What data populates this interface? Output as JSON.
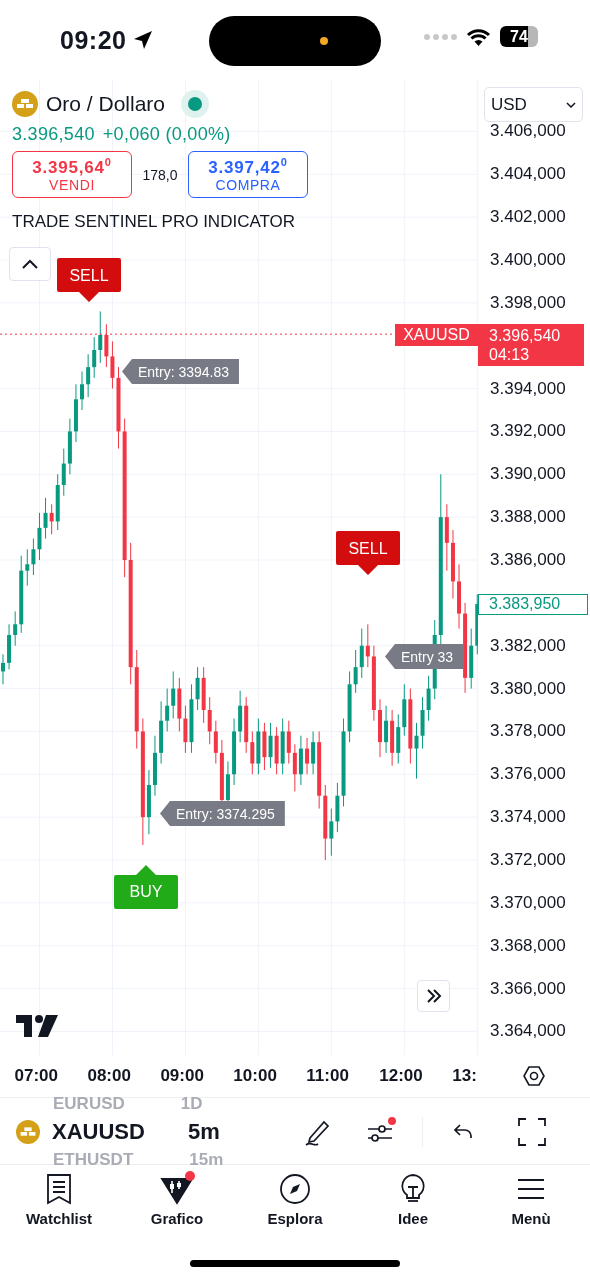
{
  "status_bar": {
    "time": "09:20",
    "battery": "74"
  },
  "symbol": {
    "name": "Oro / Dollaro",
    "market_open": true,
    "price": "3.396,540",
    "change": "+0,060 (0,00%)"
  },
  "trade": {
    "sell_price": "3.395,64$^{0}$",
    "sell_label": "VENDI",
    "spread": "178,0",
    "buy_price": "3.397,42$^{0}$",
    "buy_label": "COMPRA"
  },
  "indicator": {
    "name": "TRADE SENTINEL PRO INDICATOR",
    "expanded": true
  },
  "signals": [
    {
      "kind": "sell",
      "label": "SELL"
    },
    {
      "kind": "sell",
      "label": "SELL"
    },
    {
      "kind": "buy",
      "label": "BUY"
    }
  ],
  "entries": [
    "Entry: 3394.83",
    "Entry: 3374.295",
    "Entry 33"
  ],
  "currency": "USD",
  "chart_data": {
    "type": "candlestick",
    "x": [
      6.5,
      6.583,
      6.667,
      6.75,
      6.833,
      6.917,
      7,
      7.083,
      7.167,
      7.25,
      7.333,
      7.417,
      7.5,
      7.583,
      7.667,
      7.75,
      7.833,
      7.917,
      8,
      8.083,
      8.167,
      8.25,
      8.333,
      8.417,
      8.5,
      8.583,
      8.667,
      8.75,
      8.833,
      8.917,
      9,
      9.083,
      9.167,
      9.25,
      9.333,
      9.417,
      9.5,
      9.583,
      9.667,
      9.75,
      9.833,
      9.917,
      10,
      10.083,
      10.167,
      10.25,
      10.333,
      10.417,
      10.5,
      10.583,
      10.667,
      10.75,
      10.833,
      10.917,
      11,
      11.083,
      11.167,
      11.25,
      11.333,
      11.417,
      11.5,
      11.583,
      11.667,
      11.75,
      11.833,
      11.917,
      12,
      12.083,
      12.167,
      12.25,
      12.333,
      12.417,
      12.5,
      12.583,
      12.667,
      12.75,
      12.833,
      12.917,
      13
    ],
    "grid": true,
    "ohlc": [
      [
        3380.8,
        3381.6,
        3380.2,
        3381.2
      ],
      [
        3381.2,
        3383.0,
        3380.9,
        3382.5
      ],
      [
        3382.5,
        3383.6,
        3382.0,
        3383.0
      ],
      [
        3383.0,
        3386.2,
        3382.6,
        3385.5
      ],
      [
        3385.5,
        3386.5,
        3384.8,
        3385.8
      ],
      [
        3385.8,
        3387.0,
        3385.3,
        3386.5
      ],
      [
        3386.5,
        3388.2,
        3386.0,
        3387.5
      ],
      [
        3387.5,
        3388.9,
        3387.0,
        3388.2
      ],
      [
        3388.2,
        3388.6,
        3387.2,
        3387.8
      ],
      [
        3387.8,
        3390.0,
        3387.4,
        3389.5
      ],
      [
        3389.5,
        3391.2,
        3389.0,
        3390.5
      ],
      [
        3390.5,
        3392.6,
        3390.0,
        3392.0
      ],
      [
        3392.0,
        3394.2,
        3391.5,
        3393.5
      ],
      [
        3393.5,
        3394.8,
        3393.0,
        3394.2
      ],
      [
        3394.2,
        3395.6,
        3393.6,
        3395.0
      ],
      [
        3395.0,
        3396.4,
        3394.5,
        3395.8
      ],
      [
        3395.8,
        3397.6,
        3395.2,
        3396.5
      ],
      [
        3396.5,
        3397.0,
        3395.0,
        3395.5
      ],
      [
        3395.5,
        3396.2,
        3394.0,
        3394.5
      ],
      [
        3394.5,
        3395.0,
        3391.2,
        3392.0
      ],
      [
        3392.0,
        3392.6,
        3385.2,
        3386.0
      ],
      [
        3386.0,
        3386.8,
        3380.2,
        3381.0
      ],
      [
        3381.0,
        3381.8,
        3377.2,
        3378.0
      ],
      [
        3378.0,
        3378.6,
        3372.7,
        3374.0
      ],
      [
        3374.0,
        3376.2,
        3373.2,
        3375.5
      ],
      [
        3375.5,
        3377.8,
        3375.0,
        3377.0
      ],
      [
        3377.0,
        3379.4,
        3376.5,
        3378.5
      ],
      [
        3378.5,
        3380.0,
        3378.0,
        3379.2
      ],
      [
        3379.2,
        3380.8,
        3378.6,
        3380.0
      ],
      [
        3380.0,
        3380.5,
        3378.0,
        3378.6
      ],
      [
        3378.6,
        3379.2,
        3377.0,
        3377.5
      ],
      [
        3377.5,
        3380.2,
        3377.0,
        3379.5
      ],
      [
        3379.5,
        3381.0,
        3379.0,
        3380.5
      ],
      [
        3380.5,
        3381.0,
        3378.4,
        3379.0
      ],
      [
        3379.0,
        3379.6,
        3377.4,
        3378.0
      ],
      [
        3378.0,
        3378.5,
        3376.5,
        3377.0
      ],
      [
        3377.0,
        3377.6,
        3374.7,
        3374.8
      ],
      [
        3374.8,
        3376.6,
        3374.7,
        3376.0
      ],
      [
        3376.0,
        3378.6,
        3375.5,
        3378.0
      ],
      [
        3378.0,
        3379.9,
        3377.5,
        3379.2
      ],
      [
        3379.2,
        3379.6,
        3377.0,
        3377.5
      ],
      [
        3377.5,
        3378.0,
        3376.0,
        3376.5
      ],
      [
        3376.5,
        3378.6,
        3376.0,
        3378.0
      ],
      [
        3378.0,
        3378.4,
        3376.2,
        3376.8
      ],
      [
        3376.8,
        3378.4,
        3376.3,
        3377.8
      ],
      [
        3377.8,
        3378.2,
        3376.0,
        3376.5
      ],
      [
        3376.5,
        3378.6,
        3376.0,
        3378.0
      ],
      [
        3378.0,
        3378.5,
        3376.5,
        3377.0
      ],
      [
        3377.0,
        3377.4,
        3375.2,
        3376.0
      ],
      [
        3376.0,
        3377.8,
        3375.5,
        3377.2
      ],
      [
        3377.2,
        3377.7,
        3376.0,
        3376.5
      ],
      [
        3376.5,
        3378.0,
        3376.0,
        3377.5
      ],
      [
        3377.5,
        3378.0,
        3374.4,
        3375.0
      ],
      [
        3375.0,
        3375.5,
        3372.0,
        3373.0
      ],
      [
        3373.0,
        3374.4,
        3372.2,
        3373.8
      ],
      [
        3373.8,
        3375.6,
        3373.3,
        3375.0
      ],
      [
        3375.0,
        3378.6,
        3374.5,
        3378.0
      ],
      [
        3378.0,
        3380.8,
        3377.5,
        3380.2
      ],
      [
        3380.2,
        3381.8,
        3379.8,
        3381.0
      ],
      [
        3381.0,
        3382.8,
        3380.5,
        3382.0
      ],
      [
        3382.0,
        3383.0,
        3381.0,
        3381.5
      ],
      [
        3381.5,
        3382.0,
        3378.5,
        3379.0
      ],
      [
        3379.0,
        3379.5,
        3376.8,
        3377.5
      ],
      [
        3377.5,
        3379.2,
        3377.0,
        3378.5
      ],
      [
        3378.5,
        3379.0,
        3376.4,
        3377.0
      ],
      [
        3377.0,
        3378.8,
        3376.5,
        3378.2
      ],
      [
        3378.2,
        3380.2,
        3377.8,
        3379.5
      ],
      [
        3379.5,
        3380.0,
        3376.5,
        3377.2
      ],
      [
        3377.2,
        3378.4,
        3375.8,
        3377.8
      ],
      [
        3377.8,
        3379.6,
        3377.2,
        3379.0
      ],
      [
        3379.0,
        3380.6,
        3378.5,
        3380.0
      ],
      [
        3380.0,
        3383.2,
        3379.5,
        3382.5
      ],
      [
        3382.5,
        3390.0,
        3382.0,
        3388.0
      ],
      [
        3388.0,
        3388.6,
        3385.5,
        3386.8
      ],
      [
        3386.8,
        3387.4,
        3384.2,
        3385.0
      ],
      [
        3385.0,
        3385.8,
        3382.8,
        3383.5
      ],
      [
        3383.5,
        3384.0,
        3379.8,
        3380.5
      ],
      [
        3380.5,
        3382.8,
        3380.0,
        3382.0
      ],
      [
        3382.0,
        3384.4,
        3381.6,
        3383.95
      ]
    ],
    "xlim": [
      6.459,
      13.01
    ],
    "ylim": [
      3362.9,
      3408.4
    ],
    "ref_lines": [
      {
        "axis": "y",
        "value": 3396.54,
        "color": "#f23645"
      }
    ],
    "xticks": [
      {
        "value": 7,
        "label": "07:00"
      },
      {
        "value": 8,
        "label": "08:00"
      },
      {
        "value": 9,
        "label": "09:00"
      },
      {
        "value": 10,
        "label": "10:00"
      },
      {
        "value": 11,
        "label": "11:00"
      },
      {
        "value": 12,
        "label": "12:00"
      },
      {
        "value": 13,
        "label": "13:"
      }
    ],
    "yticks": [
      {
        "value": 3406,
        "label": "3.406,000"
      },
      {
        "value": 3404,
        "label": "3.404,000"
      },
      {
        "value": 3402,
        "label": "3.402,000"
      },
      {
        "value": 3400,
        "label": "3.400,000"
      },
      {
        "value": 3398,
        "label": "3.398,000"
      },
      {
        "value": 3394,
        "label": "3.394,000"
      },
      {
        "value": 3392,
        "label": "3.392,000"
      },
      {
        "value": 3390,
        "label": "3.390,000"
      },
      {
        "value": 3388,
        "label": "3.388,000"
      },
      {
        "value": 3386,
        "label": "3.386,000"
      },
      {
        "value": 3382,
        "label": "3.382,000"
      },
      {
        "value": 3380,
        "label": "3.380,000"
      },
      {
        "value": 3378,
        "label": "3.378,000"
      },
      {
        "value": 3376,
        "label": "3.376,000"
      },
      {
        "value": 3374,
        "label": "3.374,000"
      },
      {
        "value": 3372,
        "label": "3.372,000"
      },
      {
        "value": 3370,
        "label": "3.370,000"
      },
      {
        "value": 3368,
        "label": "3.368,000"
      },
      {
        "value": 3366,
        "label": "3.366,000"
      },
      {
        "value": 3364,
        "label": "3.364,000"
      }
    ]
  },
  "last_price": {
    "symbol": "XAUUSD",
    "price": "3.396,540",
    "countdown": "04:13"
  },
  "crosshair_price": "3.383,950",
  "toolbar": {
    "prev_symbol": "EURUSD",
    "prev_interval": "1D",
    "symbol": "XAUUSD",
    "interval": "5m",
    "next_symbol": "ETHUSDT",
    "next_interval": "15m",
    "indicators_alert": true
  },
  "nav": [
    {
      "kind": "watchlist",
      "label": "Watchlist",
      "selected": false,
      "badge": false
    },
    {
      "kind": "chart",
      "label": "Grafico",
      "selected": true,
      "badge": true
    },
    {
      "kind": "explore",
      "label": "Esplora",
      "selected": false,
      "badge": false
    },
    {
      "kind": "ideas",
      "label": "Idee",
      "selected": false,
      "badge": false
    },
    {
      "kind": "menu",
      "label": "Menù",
      "selected": false,
      "badge": false
    }
  ]
}
